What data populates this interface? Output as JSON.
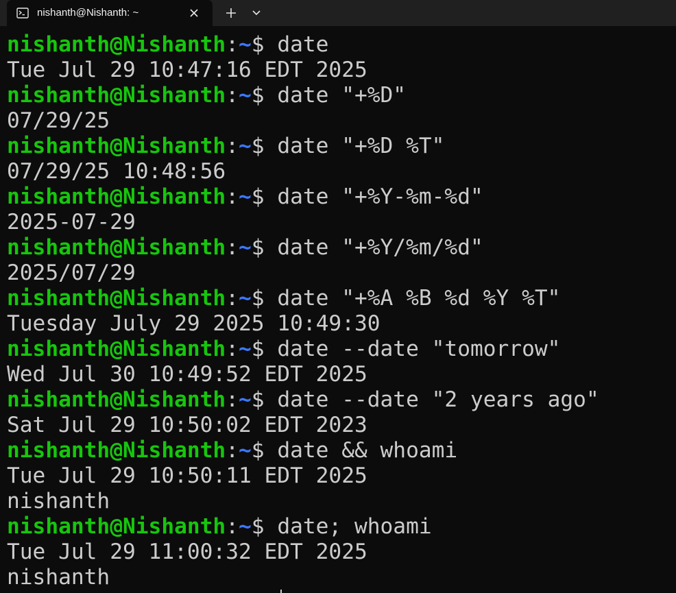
{
  "window": {
    "tab_title": "nishanth@Nishanth: ~",
    "icons": {
      "tab": "terminal-icon",
      "close": "close-icon",
      "new_tab": "plus-icon",
      "dropdown": "chevron-down-icon"
    }
  },
  "colors": {
    "background": "#0c0c0c",
    "tabbar": "#202020",
    "prompt_user": "#16c60c",
    "prompt_path": "#3b78ff",
    "text": "#cccccc"
  },
  "prompt": {
    "user": "nishanth@Nishanth",
    "sep": ":",
    "path": "~",
    "symbol": "$"
  },
  "session": [
    {
      "command": " date",
      "output": [
        "Tue Jul 29 10:47:16 EDT 2025"
      ]
    },
    {
      "command": " date \"+%D\"",
      "output": [
        "07/29/25"
      ]
    },
    {
      "command": " date \"+%D %T\"",
      "output": [
        "07/29/25 10:48:56"
      ]
    },
    {
      "command": " date \"+%Y-%m-%d\"",
      "output": [
        "2025-07-29"
      ]
    },
    {
      "command": " date \"+%Y/%m/%d\"",
      "output": [
        "2025/07/29"
      ]
    },
    {
      "command": " date \"+%A %B %d %Y %T\"",
      "output": [
        "Tuesday July 29 2025 10:49:30"
      ]
    },
    {
      "command": " date --date \"tomorrow\"",
      "output": [
        "Wed Jul 30 10:49:52 EDT 2025"
      ]
    },
    {
      "command": " date --date \"2 years ago\"",
      "output": [
        "Sat Jul 29 10:50:02 EDT 2023"
      ]
    },
    {
      "command": " date && whoami",
      "output": [
        "Tue Jul 29 10:50:11 EDT 2025",
        "nishanth"
      ]
    },
    {
      "command": " date; whoami",
      "output": [
        "Tue Jul 29 11:00:32 EDT 2025",
        "nishanth"
      ]
    }
  ]
}
